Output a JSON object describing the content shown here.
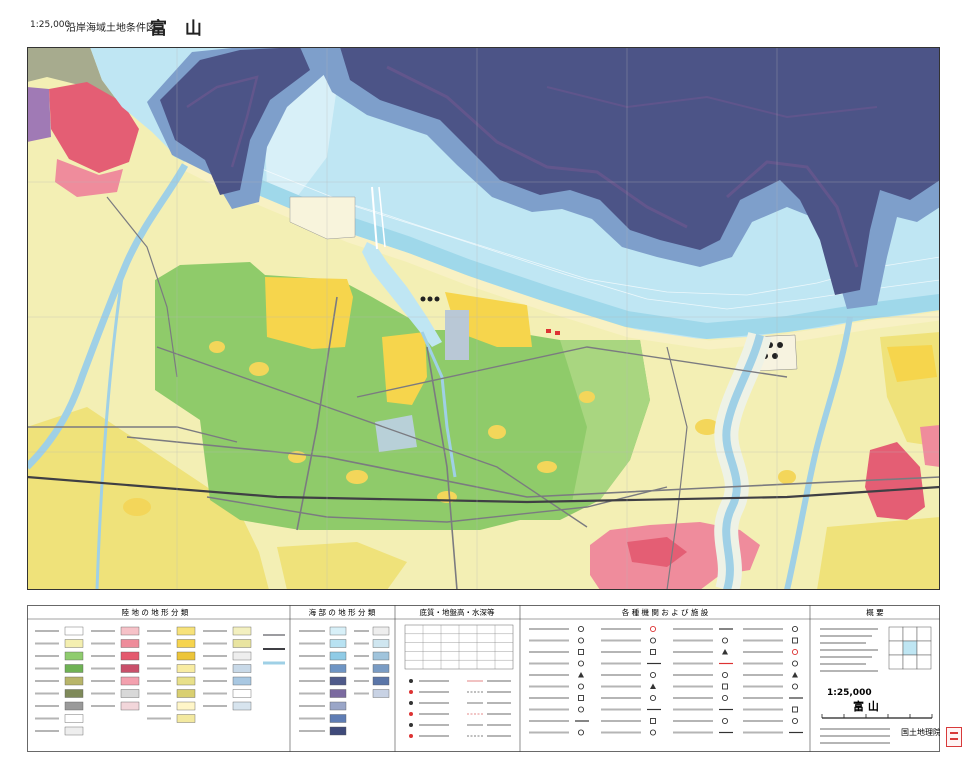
{
  "header": {
    "scale": "1:25,000",
    "series": "沿岸海域土地条件図",
    "sheet": "富 山"
  },
  "colors": {
    "land_base": "#f3efb4",
    "land_lowland": "#efe27a",
    "land_coast": "#f8f1c4",
    "green": "#8fcb6a",
    "green_light": "#a9d680",
    "yellow": "#f6d54c",
    "urban": "#ef8c9c",
    "urban_dense": "#e45e74",
    "urban_purple": "#a07ab5",
    "sea_light": "#bfe6f3",
    "sea_pale": "#d8f0f8",
    "sea_coastal": "#9fd8ea",
    "sea_mid": "#7e9fcb",
    "sea_deep": "#4c5487",
    "sea_purple": "#6c578f",
    "river": "#9fd0e6",
    "floodplain": "#eef2e6",
    "road": "#7b7b80",
    "railway": "#3f3f44"
  },
  "legend": {
    "land_title": "陸 地 の 地 形 分 類",
    "sea_title": "海 部 の 地 形 分 類",
    "sediment_title": "底質・地盤高・水深等",
    "facilities_title": "各 種 機 関 お よ び 施 設",
    "overview_title": "概 要",
    "land_swatches": [
      [
        "#ffffff",
        "#f4efb0",
        "#8fcc6e",
        "#6fb255",
        "#b8b56a",
        "#7f8a5a",
        "#9a9a9a",
        "#ffffff",
        "#eeeeee"
      ],
      [
        "#f6c2c8",
        "#ee8c9a",
        "#e45a6e",
        "#c9506a",
        "#f3a0ae",
        "#d8d8d8",
        "#f2d6da"
      ],
      [
        "#f7e27a",
        "#f6d44e",
        "#ecc53a",
        "#f8eca2",
        "#e8e08a",
        "#d9cf70",
        "#fff6c8",
        "#f3e9a0"
      ],
      [
        "#f3f0c0",
        "#e9e4a0",
        "#eeeeee",
        "#c8d9e8",
        "#a9c8e2",
        "#ffffff",
        "#d7e4ee"
      ]
    ],
    "sea_swatches": [
      [
        "#d8f0f8",
        "#b8e2f2",
        "#8fcbe6",
        "#6f95c4",
        "#4f5a8a",
        "#7b6aa0",
        "#9aa6c8",
        "#5f7db4",
        "#3f4a7a"
      ],
      [
        "#eeeeee",
        "#cfe6f0",
        "#a0c4dc",
        "#7a9cc4",
        "#5b76a8",
        "#c8d2e4"
      ]
    ],
    "facility_symbols": [
      [
        "circle-symbol",
        "circle-symbol",
        "square-symbol",
        "circle-symbol",
        "triangle-symbol",
        "circle-symbol",
        "square-symbol",
        "circle-symbol",
        "line-symbol",
        "circle-symbol"
      ],
      [
        "red-circle-symbol",
        "circle-symbol",
        "square-symbol",
        "line-symbol",
        "circle-symbol",
        "triangle-symbol",
        "circle-symbol",
        "line-symbol",
        "square-symbol",
        "circle-symbol"
      ],
      [
        "line-symbol",
        "circle-symbol",
        "triangle-symbol",
        "red-line-symbol",
        "circle-symbol",
        "square-symbol",
        "circle-symbol",
        "line-symbol",
        "circle-symbol",
        "line-symbol"
      ],
      [
        "circle-symbol",
        "square-symbol",
        "red-circle-symbol",
        "circle-symbol",
        "triangle-symbol",
        "circle-symbol",
        "line-symbol",
        "square-symbol",
        "circle-symbol",
        "line-symbol"
      ]
    ]
  },
  "overview": {
    "scale": "1:25,000",
    "sheet": "富 山",
    "publisher": "国土地理院"
  }
}
